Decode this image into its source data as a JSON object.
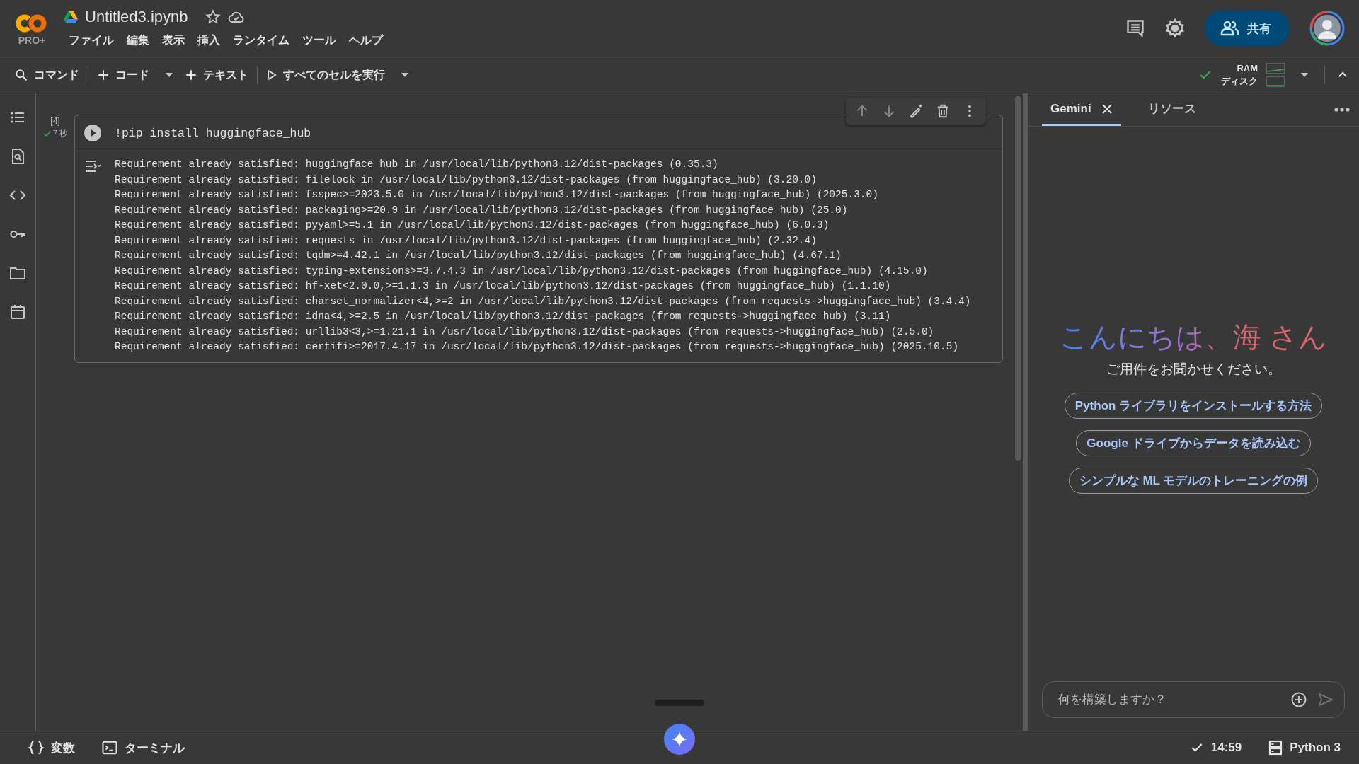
{
  "app": {
    "logo_badge": "PRO+"
  },
  "document": {
    "title": "Untitled3.ipynb",
    "starred": false
  },
  "menu": [
    "ファイル",
    "編集",
    "表示",
    "挿入",
    "ランタイム",
    "ツール",
    "ヘルプ"
  ],
  "header_actions": {
    "share_label": "共有"
  },
  "toolbar": [
    {
      "kind": "search",
      "label": "コマンド",
      "dropdown": false
    },
    {
      "kind": "add",
      "label": "コード",
      "dropdown": true
    },
    {
      "kind": "add",
      "label": "テキスト",
      "dropdown": false
    },
    {
      "kind": "run",
      "label": "すべてのセルを実行",
      "dropdown": true
    }
  ],
  "resources": {
    "ram_label": "RAM",
    "disk_label": "ディスク",
    "connected": true
  },
  "cell": {
    "execution_count": "[4]",
    "duration": "7 秒",
    "succeeded": true,
    "code": "!pip install huggingface_hub",
    "output": [
      "Requirement already satisfied: huggingface_hub in /usr/local/lib/python3.12/dist-packages (0.35.3)",
      "Requirement already satisfied: filelock in /usr/local/lib/python3.12/dist-packages (from huggingface_hub) (3.20.0)",
      "Requirement already satisfied: fsspec>=2023.5.0 in /usr/local/lib/python3.12/dist-packages (from huggingface_hub) (2025.3.0)",
      "Requirement already satisfied: packaging>=20.9 in /usr/local/lib/python3.12/dist-packages (from huggingface_hub) (25.0)",
      "Requirement already satisfied: pyyaml>=5.1 in /usr/local/lib/python3.12/dist-packages (from huggingface_hub) (6.0.3)",
      "Requirement already satisfied: requests in /usr/local/lib/python3.12/dist-packages (from huggingface_hub) (2.32.4)",
      "Requirement already satisfied: tqdm>=4.42.1 in /usr/local/lib/python3.12/dist-packages (from huggingface_hub) (4.67.1)",
      "Requirement already satisfied: typing-extensions>=3.7.4.3 in /usr/local/lib/python3.12/dist-packages (from huggingface_hub) (4.15.0)",
      "Requirement already satisfied: hf-xet<2.0.0,>=1.1.3 in /usr/local/lib/python3.12/dist-packages (from huggingface_hub) (1.1.10)",
      "Requirement already satisfied: charset_normalizer<4,>=2 in /usr/local/lib/python3.12/dist-packages (from requests->huggingface_hub) (3.4.4)",
      "Requirement already satisfied: idna<4,>=2.5 in /usr/local/lib/python3.12/dist-packages (from requests->huggingface_hub) (3.11)",
      "Requirement already satisfied: urllib3<3,>=1.21.1 in /usr/local/lib/python3.12/dist-packages (from requests->huggingface_hub) (2.5.0)",
      "Requirement already satisfied: certifi>=2017.4.17 in /usr/local/lib/python3.12/dist-packages (from requests->huggingface_hub) (2025.10.5)"
    ]
  },
  "gemini_panel": {
    "tabs": [
      {
        "label": "Gemini",
        "selected": true,
        "closable": true
      },
      {
        "label": "リソース",
        "selected": false,
        "closable": false
      }
    ],
    "greeting": "こんにちは、海 さん",
    "subtitle": "ご用件をお聞かせください。",
    "suggestions": [
      "Python ライブラリをインストールする方法",
      "Google ドライブからデータを読み込む",
      "シンプルな ML モデルのトレーニングの例"
    ],
    "input": {
      "placeholder": "何を構築しますか？"
    }
  },
  "status_bar": {
    "variables": "変数",
    "terminal": "ターミナル",
    "time": "14:59",
    "runtime": "Python 3"
  }
}
